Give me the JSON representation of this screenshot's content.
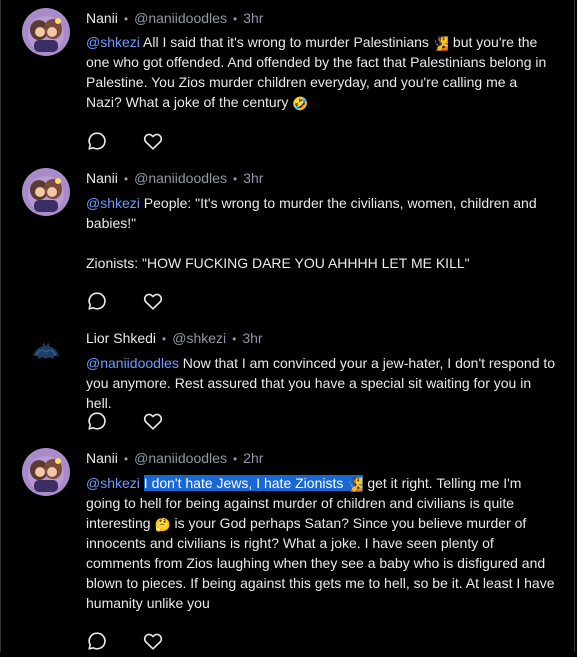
{
  "posts": [
    {
      "name": "Nanii",
      "handle": "@naniidoodles",
      "time": "3hr",
      "mention": "@shkezi",
      "text1": " All I said that it's wrong to murder Palestinians ",
      "emoji1": "🧏",
      "text2": " but you're the one who got offended. And offended by the fact that Palestinians belong in Palestine. You Zios murder children everyday, and you're calling me a Nazi? What a joke of the century ",
      "emoji2": "🤣",
      "avatar_icon": "avatar-drawing-icon"
    },
    {
      "name": "Nanii",
      "handle": "@naniidoodles",
      "time": "3hr",
      "mention": "@shkezi",
      "line1": " People: \"It's wrong to murder the civilians, women, children and babies!\"",
      "line2": "Zionists: \"HOW FUCKING DARE YOU AHHHH LET ME KILL\"",
      "avatar_icon": "avatar-drawing-icon"
    },
    {
      "name": "Lior Shkedi",
      "handle": "@shkezi",
      "time": "3hr",
      "mention": "@naniidoodles",
      "text": " Now that I am convinced your a jew-hater, I don't respond to you anymore. Rest assured that you have a special sit waiting for you in hell.",
      "avatar_icon": "avatar-batman-icon"
    },
    {
      "name": "Nanii",
      "handle": "@naniidoodles",
      "time": "2hr",
      "mention": "@shkezi",
      "space": " ",
      "highlight": "I don't hate Jews, I hate Zionists ",
      "emoji1": "🧏",
      "text2": " get it right. Telling me I'm going to hell for being against murder of children and civilians is quite interesting ",
      "emoji2": "🤔",
      "text3": " is your God perhaps Satan? Since you believe murder of innocents and civilians is right? What a joke. I have seen plenty of comments from Zios laughing when they see a baby who is disfigured and blown to pieces. If being against this gets me to hell, so be it. At least I have humanity unlike you",
      "avatar_icon": "avatar-drawing-icon"
    }
  ],
  "actions": {
    "reply_icon": "reply-icon",
    "like_icon": "heart-icon"
  },
  "separator": "•",
  "colors": {
    "background": "#000000",
    "text": "#e7e9ea",
    "muted": "#8b98a5",
    "mention": "#6c9bff",
    "highlight": "#1967d2"
  }
}
